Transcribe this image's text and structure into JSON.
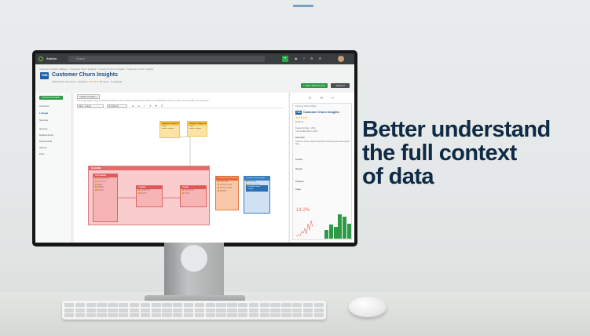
{
  "headline": [
    "Better understand",
    "the full context",
    "of data"
  ],
  "app": {
    "brand": "Alation",
    "search_placeholder": "Search",
    "breadcrumb": "Customer Insights Tableau > Customer Churn Insights > Customer Churn Insights > Customer Churn Insights",
    "title": "Customer Churn Insights",
    "badge": "TWB",
    "meta": {
      "certified": "Endorsed by Someone",
      "rating_label": "Excellent",
      "stars": "★★★★★",
      "views": "28 views",
      "stewards": "6 stewards"
    },
    "buttons": {
      "add": "+ Add to Data Sources",
      "actions": "Actions ▾"
    },
    "sidebar": {
      "cta": "Add Documentation",
      "items": [
        "Overview",
        "Lineage",
        "Sources",
        "Queries",
        "Relationships",
        "Dashboards",
        "Sheets",
        "Files"
      ],
      "active_index": 1
    },
    "canvas": {
      "tab": "Impact Lineage ×",
      "description": "This lineage graph shows the full path of data from source tables through transformations to the dashboard. Select any node to see its details in the side panel.",
      "toolbar": {
        "view": "Table - Column",
        "filter": "All Columns",
        "icons": "⊕ ⊖ ⤢ ↺ ⚑ ☰"
      },
      "top_cards": [
        {
          "title": "Customer Support Tickets",
          "lines": [
            "VIEW",
            "Select Columns"
          ]
        },
        {
          "title": "Customer Segments",
          "lines": [
            "VIEW",
            "Select Columns"
          ]
        }
      ],
      "region_title": "SALESDB",
      "left_node": {
        "title": "CUSTOMERS",
        "rows": [
          "CustomerID",
          "Customer Name",
          "Churn Date",
          "Region",
          "Segment",
          "Revenue"
        ]
      },
      "mid_node": {
        "title": "ORDERS",
        "rows": [
          "OrderID",
          "Customer ID",
          "Amount"
        ]
      },
      "right_node": {
        "title": "CHURN",
        "rows": [
          "CustomerID",
          "Churn Score",
          "Tenure"
        ]
      },
      "orange_node": {
        "title": "Customer Churn Dashboard",
        "rows": [
          "Churn Rate",
          "Customer Count",
          "Revenue at Risk",
          "Segment"
        ]
      },
      "blue_node": {
        "title": "Customer Churn Insights",
        "rows": [
          "Dashboard",
          "Churn Overview"
        ],
        "selected": "Customer Churn Insights"
      }
    },
    "panel": {
      "header": "Customer Churn Insights",
      "badge": "TWB",
      "stars": "★★★★★",
      "lines": [
        "Endorsed",
        "Created by   May 1, 2023",
        "Last modified   May 3, 2023",
        "Description",
        "Customer churn insights dashboard combining sales and support data.",
        "Certified",
        "Steward",
        "Popularity",
        "Usage"
      ],
      "metric": "14.2%",
      "bars": [
        0.35,
        0.55,
        0.45,
        0.95,
        0.85,
        0.6
      ],
      "colors": {
        "metric": "#e36b6b",
        "bars": "#2e9a46"
      }
    }
  }
}
